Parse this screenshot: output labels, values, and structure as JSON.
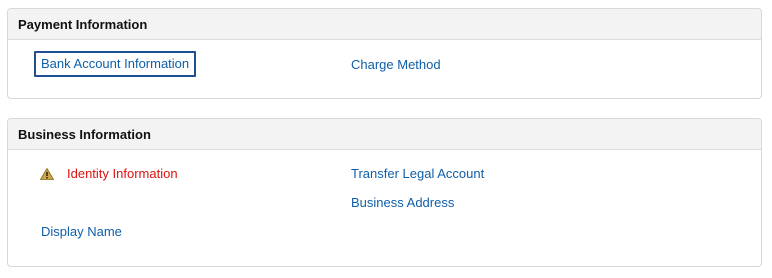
{
  "payment": {
    "title": "Payment Information",
    "links": {
      "bank_account": "Bank Account Information",
      "charge_method": "Charge Method"
    }
  },
  "business": {
    "title": "Business Information",
    "links": {
      "identity": "Identity Information",
      "transfer_legal_account": "Transfer Legal Account",
      "business_address": "Business Address",
      "display_name": "Display Name"
    },
    "identity_icon": "warning-icon",
    "identity_color": "#e01111"
  },
  "colors": {
    "link": "#0f5fa8",
    "header_bg": "#f3f3f3",
    "focus_border": "#1d4f91"
  }
}
